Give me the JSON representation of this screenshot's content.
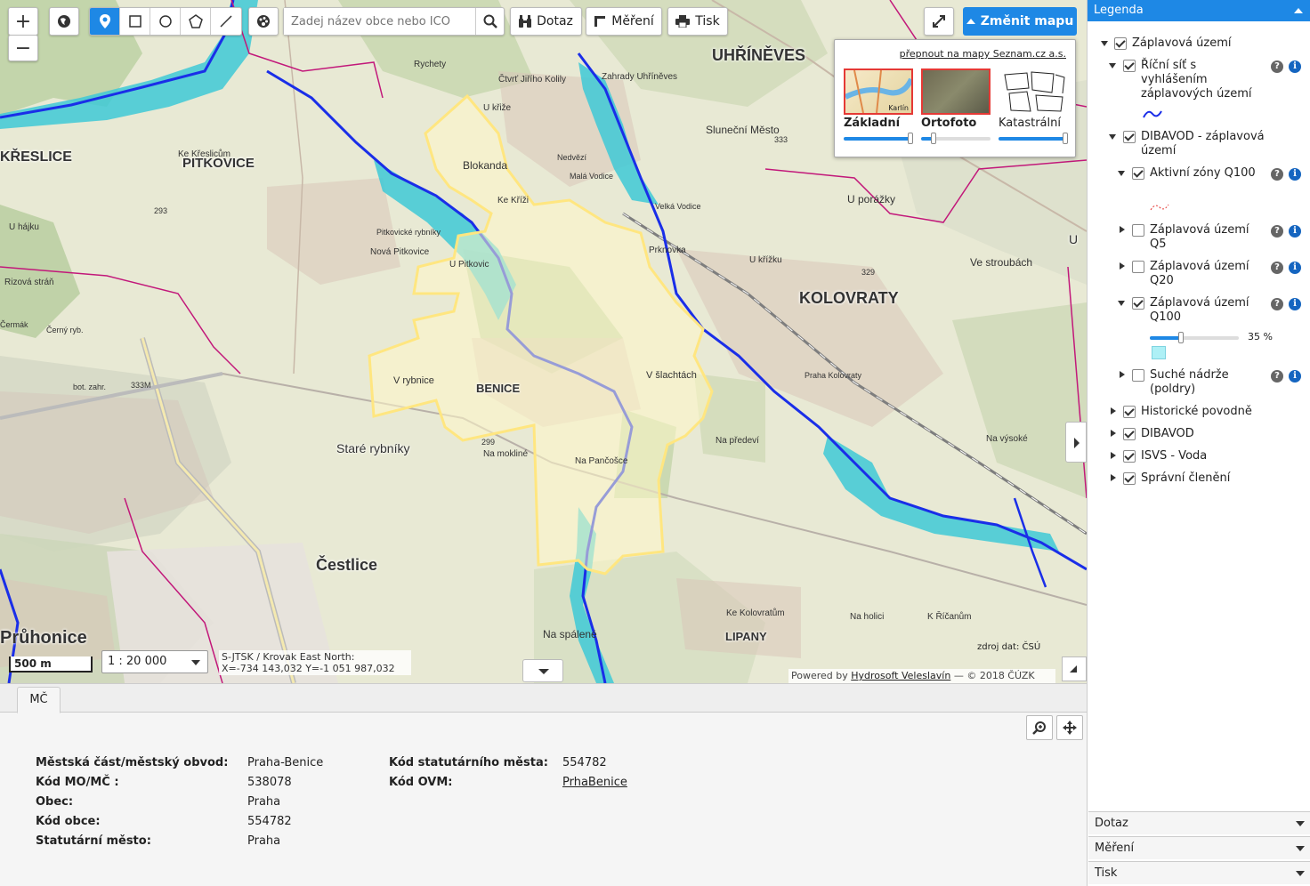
{
  "toolbar": {
    "zoom_in": "+",
    "zoom_out": "−",
    "search_placeholder": "Zadej název obce nebo IČO",
    "query_label": "Dotaz",
    "measure_label": "Měření",
    "print_label": "Tisk",
    "change_map_label": "Změnit mapu"
  },
  "basemaps": {
    "switch_link": "přepnout na mapy Seznam.cz a.s.",
    "items": [
      {
        "label": "Základní",
        "selected": true,
        "opacity": 1.0
      },
      {
        "label": "Ortofoto",
        "selected": true,
        "opacity": 0.15
      },
      {
        "label": "Katastrální",
        "selected": false,
        "opacity": 1.0
      }
    ],
    "thumb_text": "Karlín"
  },
  "map": {
    "scale_bar": "500 m",
    "scale": "1 : 20 000",
    "coords_line1": "S-JTSK / Krovak East North:",
    "coords_line2": "X=-734 143,032 Y=-1 051 987,032",
    "powered_prefix": "Powered by",
    "powered_link": "Hydrosoft Veleslavín",
    "powered_suffix": "— © 2018 ČÚZK",
    "source": "zdroj dat: ČSÚ",
    "labels": [
      {
        "text": "UHŘÍNĚVES",
        "cls": "big"
      },
      {
        "text": "KOLOVRATY",
        "cls": "big"
      },
      {
        "text": "KŘESLICE",
        "cls": "big"
      },
      {
        "text": "PITKOVICE",
        "cls": "big"
      },
      {
        "text": "BENICE",
        "cls": "mid"
      },
      {
        "text": "LIPANY",
        "cls": "mid"
      },
      {
        "text": "Čestlice",
        "cls": "big2"
      },
      {
        "text": "Průhonice",
        "cls": "big2"
      },
      {
        "text": "Staré rybníky",
        "cls": "med"
      },
      {
        "text": "Blokanda",
        "cls": "small"
      },
      {
        "text": "V rybnice",
        "cls": "small"
      },
      {
        "text": "V šlachtách",
        "cls": "small"
      },
      {
        "text": "Na Pančošce",
        "cls": "small"
      },
      {
        "text": "U porážky",
        "cls": "small"
      },
      {
        "text": "Ve stroubách",
        "cls": "small"
      },
      {
        "text": "Sluneční Město",
        "cls": "small"
      },
      {
        "text": "Prknovka",
        "cls": "small"
      },
      {
        "text": "U křížku",
        "cls": "small"
      },
      {
        "text": "Na předeví",
        "cls": "small"
      },
      {
        "text": "Na výsoké",
        "cls": "small"
      },
      {
        "text": "Na spálené",
        "cls": "small"
      },
      {
        "text": "Na holici",
        "cls": "small"
      },
      {
        "text": "K Říčanům",
        "cls": "small"
      },
      {
        "text": "Ke Kolovratům",
        "cls": "small"
      },
      {
        "text": "Nová Pitkovice",
        "cls": "small"
      },
      {
        "text": "U Pitkovic",
        "cls": "small"
      },
      {
        "text": "Na mokliné",
        "cls": "small"
      },
      {
        "text": "Rychety",
        "cls": "small"
      },
      {
        "text": "Ke Křeslicům",
        "cls": "small"
      },
      {
        "text": "U hájku",
        "cls": "small"
      },
      {
        "text": "Rizová stráň",
        "cls": "small"
      },
      {
        "text": "U křiže",
        "cls": "small"
      },
      {
        "text": "Ke Kříži",
        "cls": "small"
      },
      {
        "text": "Čtvrť Jiřího Kolily",
        "cls": "small"
      },
      {
        "text": "Zahrady Uhříněves",
        "cls": "small"
      },
      {
        "text": "Praha Kolovraty",
        "cls": "small"
      },
      {
        "text": "Velká Vodice",
        "cls": "small"
      },
      {
        "text": "Nedvězí",
        "cls": "small"
      },
      {
        "text": "Malá Vodice",
        "cls": "small"
      },
      {
        "text": "Pitkovické rybníky",
        "cls": "small"
      },
      {
        "text": "Černý ryb.",
        "cls": "small"
      },
      {
        "text": "Čermák",
        "cls": "small"
      },
      {
        "text": "bot. zahr.",
        "cls": "small"
      },
      {
        "text": "333M",
        "cls": "small"
      },
      {
        "text": "333",
        "cls": "small"
      },
      {
        "text": "299",
        "cls": "small"
      },
      {
        "text": "293",
        "cls": "small"
      },
      {
        "text": "329",
        "cls": "small"
      },
      {
        "text": "U",
        "cls": "small"
      }
    ]
  },
  "bottom": {
    "tab": "MČ",
    "left_keys": [
      "Městská část/městský obvod:",
      "Kód MO/MČ :",
      "Obec:",
      "Kód obce:",
      "Statutární město:"
    ],
    "left_vals": [
      "Praha-Benice",
      "538078",
      "Praha",
      "554782",
      "Praha"
    ],
    "right_keys": [
      "Kód statutárního města:",
      "Kód OVM:"
    ],
    "right_vals": [
      "554782",
      "PrhaBenice"
    ]
  },
  "legend": {
    "title": "Legenda",
    "items": [
      {
        "label": "Záplavová území",
        "checked": true,
        "expand": "down"
      },
      {
        "label": "Říční síť s vyhlášením záplavových území",
        "checked": true,
        "expand": "down"
      },
      {
        "label": "DIBAVOD - záplavová území",
        "checked": true,
        "expand": "down"
      },
      {
        "label": "Aktivní zóny Q100",
        "checked": true,
        "expand": "down"
      },
      {
        "label": "Záplavová území Q5",
        "checked": false,
        "expand": "right"
      },
      {
        "label": "Záplavová území Q20",
        "checked": false,
        "expand": "right"
      },
      {
        "label": "Záplavová území Q100",
        "checked": true,
        "expand": "down"
      },
      {
        "label": "Suché nádrže (poldry)",
        "checked": false,
        "expand": "right"
      },
      {
        "label": "Historické povodně",
        "checked": true,
        "expand": "right"
      },
      {
        "label": "DIBAVOD",
        "checked": true,
        "expand": "right"
      },
      {
        "label": "ISVS - Voda",
        "checked": true,
        "expand": "right"
      },
      {
        "label": "Správní členění",
        "checked": true,
        "expand": "right"
      }
    ],
    "q100_opacity_label": "35 %",
    "q100_opacity": 0.35,
    "accordion": [
      "Dotaz",
      "Měření",
      "Tisk"
    ]
  },
  "colors": {
    "accent": "#1e88e5",
    "boundary": "#ffe680",
    "river": "#1a2ee8",
    "flood": "#3ec9d6",
    "admin": "#c2187a"
  }
}
